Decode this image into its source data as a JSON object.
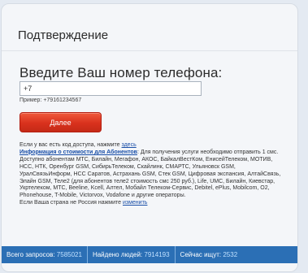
{
  "title": "Подтверждение",
  "phone": {
    "heading": "Введите Ваш номер телефона:",
    "value": "+7",
    "example": "Пример: +79161234567"
  },
  "submit_label": "Далее",
  "info": {
    "code_prefix": "Если у вас есть код доступа, нажмите ",
    "code_link": "здесь",
    "cost_link": "Информация о стоимости для Абонентов",
    "cost_text": ": Для получения услуги необходимо отправить 1 смс. Доступно абонентам МТС, Билайн, Мегафон, АКОС, БайкалВестКом, ЕнисейТелеком, МОТИВ, НСС, НТК, Оренбург GSM, СибирьТелеком, Скайлинк, СМАРТС, Ульяновск GSM, УралСвязьИнформ, НСС Саратов, Астрахань GSM, Стек GSM, Цифровая экспансия, АлтайСвязь, Элайн GSM, Теле2 (для абонентов теле2 стоимость смс 250 руб.), Life, UMC, Билайн, Киевстар, Укртелеком, МТС, Beeline, Kcell, Алтел, Мобайл Телеком-Сервис, Debitel, ePlus, Mobilcom, O2, Phonehouse, T-Mobile, Victorvox, Vodafone и другие операторы.",
    "country_prefix": "Если Ваша страна не Россия нажмите ",
    "country_link": "изменить"
  },
  "stats": {
    "requests_label": "Всего запросов:",
    "requests_value": "7585021",
    "found_label": "Найдено людей:",
    "found_value": "7914193",
    "searching_label": "Сейчас ищут:",
    "searching_value": "2532"
  },
  "colors": {
    "accent_button": "#d9311d",
    "stats_bar": "#2b6fb5",
    "link": "#1a4fa8"
  }
}
